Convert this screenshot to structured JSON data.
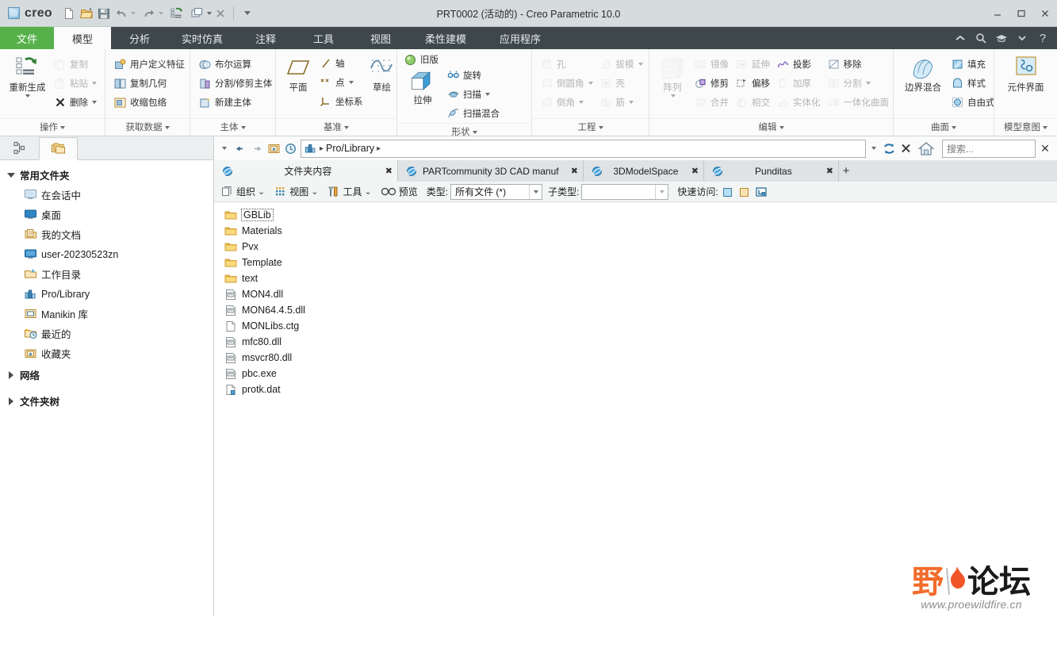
{
  "window": {
    "title": "PRT0002 (活动的) - Creo Parametric 10.0",
    "brand": "creo",
    "minimize": "—",
    "maximize": "▢",
    "close": "✕"
  },
  "quick_access": {
    "items": [
      {
        "name": "new-document-icon",
        "tooltip": "新建"
      },
      {
        "name": "open-folder-icon",
        "tooltip": "打开"
      },
      {
        "name": "save-icon",
        "tooltip": "保存"
      },
      {
        "name": "undo-icon",
        "tooltip": "撤消"
      },
      {
        "name": "redo-icon",
        "tooltip": "重做"
      },
      {
        "name": "regenerate-icon",
        "tooltip": "重新生成"
      },
      {
        "name": "window-switch-icon",
        "tooltip": "窗口"
      },
      {
        "name": "close-window-icon",
        "tooltip": "关闭"
      },
      {
        "name": "qat-overflow-icon",
        "tooltip": "自定义快速访问工具栏"
      }
    ]
  },
  "ribbon": {
    "tabs": [
      {
        "label": "文件",
        "state": "file"
      },
      {
        "label": "模型",
        "state": "active"
      },
      {
        "label": "分析",
        "state": "normal"
      },
      {
        "label": "实时仿真",
        "state": "normal"
      },
      {
        "label": "注释",
        "state": "normal"
      },
      {
        "label": "工具",
        "state": "normal"
      },
      {
        "label": "视图",
        "state": "normal"
      },
      {
        "label": "柔性建模",
        "state": "normal"
      },
      {
        "label": "应用程序",
        "state": "normal"
      }
    ],
    "tabs_right_icons": [
      "collapse-ribbon-icon",
      "search-icon",
      "graduation-cap-icon",
      "chevron-down-icon",
      "help-icon"
    ],
    "groups": [
      {
        "label": "操作",
        "big": {
          "label": "重新生成",
          "icon": "regenerate-icon",
          "has_caret": true,
          "disabled": false
        },
        "items": [
          {
            "label": "复制",
            "icon": "copy-icon",
            "disabled": true,
            "caret": false
          },
          {
            "label": "粘贴",
            "icon": "paste-icon",
            "disabled": true,
            "caret": true
          },
          {
            "label": "删除",
            "icon": "delete-x-icon",
            "disabled": false,
            "caret": true
          }
        ]
      },
      {
        "label": "获取数据",
        "items": [
          {
            "label": "用户定义特征",
            "icon": "udf-icon",
            "disabled": false,
            "caret": false
          },
          {
            "label": "复制几何",
            "icon": "copy-geometry-icon",
            "disabled": false,
            "caret": false
          },
          {
            "label": "收缩包络",
            "icon": "shrinkwrap-icon",
            "disabled": false,
            "caret": false
          }
        ]
      },
      {
        "label": "主体",
        "items": [
          {
            "label": "布尔运算",
            "icon": "boolean-icon",
            "disabled": false,
            "caret": false
          },
          {
            "label": "分割/修剪主体",
            "icon": "split-body-icon",
            "disabled": false,
            "caret": false
          },
          {
            "label": "新建主体",
            "icon": "new-body-icon",
            "disabled": false,
            "caret": false
          }
        ]
      },
      {
        "label": "基准",
        "big_left": {
          "label": "平面",
          "icon": "datum-plane-icon"
        },
        "items": [
          {
            "label": "轴",
            "icon": "datum-axis-icon",
            "disabled": false,
            "caret": false
          },
          {
            "label": "点",
            "icon": "datum-point-icon",
            "disabled": false,
            "caret": true
          },
          {
            "label": "坐标系",
            "icon": "coordinate-system-icon",
            "disabled": false,
            "caret": false
          }
        ],
        "big_right": {
          "label": "草绘",
          "icon": "sketch-icon"
        }
      },
      {
        "label": "形状",
        "legacy": {
          "label": "旧版",
          "icon": "legacy-icon"
        },
        "big": {
          "label": "拉伸",
          "icon": "extrude-icon"
        },
        "items": [
          {
            "label": "旋转",
            "icon": "revolve-icon",
            "disabled": false,
            "caret": false
          },
          {
            "label": "扫描",
            "icon": "sweep-icon",
            "disabled": false,
            "caret": true
          },
          {
            "label": "扫描混合",
            "icon": "swept-blend-icon",
            "disabled": false,
            "caret": false
          }
        ]
      },
      {
        "label": "工程",
        "col1": [
          {
            "label": "孔",
            "icon": "hole-icon",
            "disabled": true,
            "caret": false
          },
          {
            "label": "倒圆角",
            "icon": "round-icon",
            "disabled": true,
            "caret": true
          },
          {
            "label": "倒角",
            "icon": "chamfer-icon",
            "disabled": true,
            "caret": true
          }
        ],
        "col2": [
          {
            "label": "拔模",
            "icon": "draft-icon",
            "disabled": true,
            "caret": true
          },
          {
            "label": "壳",
            "icon": "shell-icon",
            "disabled": true,
            "caret": false
          },
          {
            "label": "筋",
            "icon": "rib-icon",
            "disabled": true,
            "caret": true
          }
        ]
      },
      {
        "label": "编辑",
        "big": {
          "label": "阵列",
          "icon": "pattern-icon",
          "has_caret": true,
          "disabled": true
        },
        "col1": [
          {
            "label": "镜像",
            "icon": "mirror-icon",
            "disabled": true,
            "caret": false
          },
          {
            "label": "修剪",
            "icon": "trim-icon",
            "disabled": false,
            "caret": false
          },
          {
            "label": "合并",
            "icon": "merge-icon",
            "disabled": true,
            "caret": false
          }
        ],
        "col2": [
          {
            "label": "延伸",
            "icon": "extend-icon",
            "disabled": true,
            "caret": false
          },
          {
            "label": "偏移",
            "icon": "offset-icon",
            "disabled": false,
            "caret": false
          },
          {
            "label": "相交",
            "icon": "intersect-icon",
            "disabled": true,
            "caret": false
          }
        ],
        "col3": [
          {
            "label": "投影",
            "icon": "project-icon",
            "disabled": false,
            "caret": false
          },
          {
            "label": "加厚",
            "icon": "thicken-icon",
            "disabled": true,
            "caret": false
          },
          {
            "label": "实体化",
            "icon": "solidify-icon",
            "disabled": true,
            "caret": false
          }
        ],
        "col4": [
          {
            "label": "移除",
            "icon": "remove-surface-icon",
            "disabled": false,
            "caret": false
          },
          {
            "label": "分割",
            "icon": "split-surface-icon",
            "disabled": true,
            "caret": true
          },
          {
            "label": "一体化曲面",
            "icon": "unified-surface-icon",
            "disabled": true,
            "caret": false
          }
        ]
      },
      {
        "label": "曲面",
        "big": {
          "label": "边界混合",
          "icon": "boundary-blend-icon"
        },
        "items": [
          {
            "label": "填充",
            "icon": "fill-icon",
            "disabled": false,
            "caret": false
          },
          {
            "label": "样式",
            "icon": "style-icon",
            "disabled": false,
            "caret": false
          },
          {
            "label": "自由式",
            "icon": "freestyle-icon",
            "disabled": false,
            "caret": false
          }
        ]
      },
      {
        "label": "模型意图",
        "big": {
          "label": "元件界面",
          "icon": "component-interface-icon"
        }
      }
    ]
  },
  "navigator": {
    "tabs": [
      {
        "name": "model-tree-tab",
        "active": false
      },
      {
        "name": "folder-browser-tab",
        "active": true
      }
    ],
    "sections": [
      {
        "label": "常用文件夹",
        "expanded": true,
        "items": [
          {
            "label": "在会话中",
            "icon": "in-session-icon"
          },
          {
            "label": "桌面",
            "icon": "desktop-icon"
          },
          {
            "label": "我的文档",
            "icon": "my-documents-icon"
          },
          {
            "label": "user-20230523zn",
            "icon": "computer-icon"
          },
          {
            "label": "工作目录",
            "icon": "working-directory-icon"
          },
          {
            "label": "Pro/Library",
            "icon": "pro-library-icon"
          },
          {
            "label": "Manikin 库",
            "icon": "manikin-library-icon"
          },
          {
            "label": "最近的",
            "icon": "recent-icon"
          },
          {
            "label": "收藏夹",
            "icon": "favorites-icon"
          }
        ]
      },
      {
        "label": "网络",
        "expanded": false,
        "items": []
      },
      {
        "label": "文件夹树",
        "expanded": false,
        "items": []
      }
    ]
  },
  "browser": {
    "address": {
      "back_icon": "back-arrow-icon",
      "forward_icon": "forward-arrow-icon",
      "favorites_icon": "favorites-folder-icon",
      "history_icon": "history-clock-icon",
      "path_icon": "pro-library-icon",
      "path_segments": [
        "Pro/Library"
      ],
      "dropdown_icon": "chevron-down-icon",
      "refresh_icon": "refresh-icon",
      "stop_icon": "stop-x-icon",
      "home_icon": "home-icon",
      "search_placeholder": "搜索...",
      "close_icon": "close-x-icon"
    },
    "tabs": [
      {
        "label": "文件夹内容",
        "active": true,
        "icon": "browser-globe-icon",
        "close": "✖"
      },
      {
        "label": "PARTcommunity 3D CAD manuf",
        "active": false,
        "icon": "browser-globe-icon",
        "close": "✖"
      },
      {
        "label": "3DModelSpace",
        "active": false,
        "icon": "browser-globe-icon",
        "close": "✖"
      },
      {
        "label": "Punditas",
        "active": false,
        "icon": "browser-globe-icon",
        "close": "✖"
      },
      {
        "label": "+",
        "active": false,
        "icon": "add-tab-icon",
        "is_add": true
      }
    ],
    "toolbar": {
      "organize_label": "组织",
      "organize_icon": "organize-icon",
      "view_label": "视图",
      "view_icon": "view-grid-icon",
      "tools_label": "工具",
      "tools_icon": "tools-icon",
      "preview_label": "预览",
      "preview_icon": "preview-glasses-icon",
      "type_label": "类型:",
      "type_value": "所有文件 (*)",
      "subtype_label": "子类型:",
      "subtype_value": "",
      "quick_access_label": "快速访问:",
      "quick_access_icons": [
        "blue-cube-icon",
        "yellow-folder-cube-icon",
        "workspace-icon"
      ]
    },
    "files": [
      {
        "name": "GBLib",
        "type": "folder",
        "selected": true
      },
      {
        "name": "Materials",
        "type": "folder",
        "selected": false
      },
      {
        "name": "Pvx",
        "type": "folder",
        "selected": false
      },
      {
        "name": "Template",
        "type": "folder",
        "selected": false
      },
      {
        "name": "text",
        "type": "folder",
        "selected": false
      },
      {
        "name": "MON4.dll",
        "type": "dll",
        "selected": false
      },
      {
        "name": "MON64.4.5.dll",
        "type": "dll",
        "selected": false
      },
      {
        "name": "MONLibs.ctg",
        "type": "file",
        "selected": false
      },
      {
        "name": "mfc80.dll",
        "type": "dll",
        "selected": false
      },
      {
        "name": "msvcr80.dll",
        "type": "dll",
        "selected": false
      },
      {
        "name": "pbc.exe",
        "type": "dll",
        "selected": false
      },
      {
        "name": "protk.dat",
        "type": "dat",
        "selected": false
      }
    ]
  },
  "watermark": {
    "text_1": "野",
    "text_2": "论坛",
    "url": "www.proewildfire.cn"
  },
  "colors": {
    "accent_green": "#56b14a",
    "ribbon_dark": "#3e484c",
    "titlebar": "#d6dbdd",
    "folder_yellow": "#f0c868",
    "watermark_orange": "#f26c2b"
  }
}
